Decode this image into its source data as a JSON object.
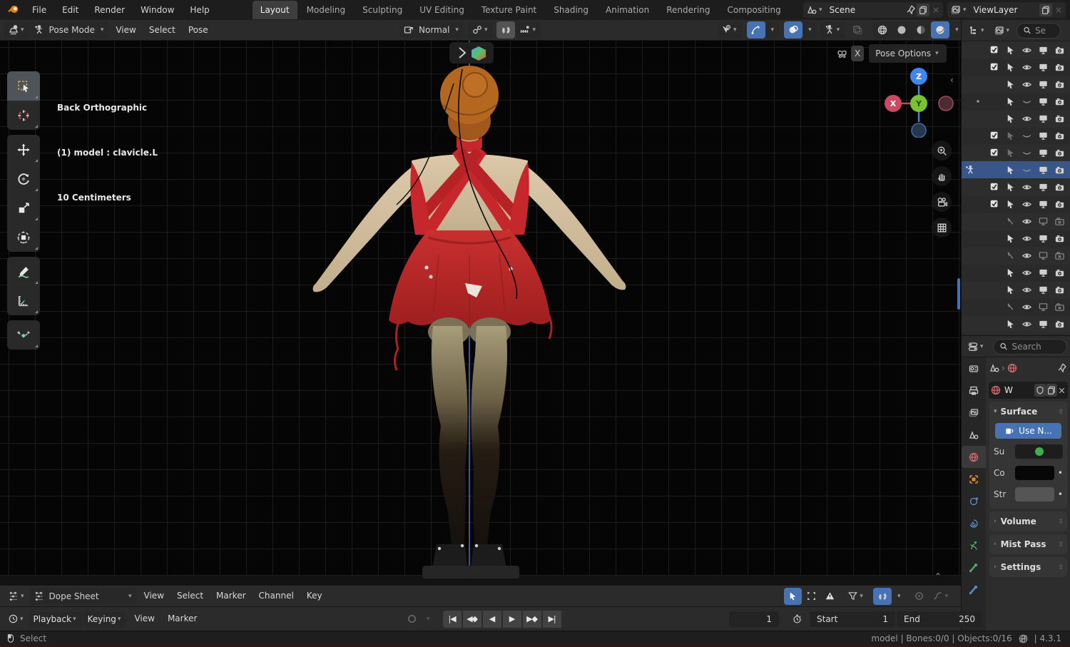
{
  "colors": {
    "accent": "#4772b3",
    "selection_row": "#38568a",
    "world_icon": "#d46a6a",
    "object_icon": "#e0862d",
    "data_icon": "#4fb06a",
    "physics_icon": "#5f8fd2",
    "dress_red": "#c5272c",
    "hair_orange": "#b4671f"
  },
  "topbar": {
    "menus": [
      "File",
      "Edit",
      "Render",
      "Window",
      "Help"
    ],
    "workspaces": [
      {
        "label": "Layout",
        "active": true
      },
      {
        "label": "Modeling"
      },
      {
        "label": "Sculpting"
      },
      {
        "label": "UV Editing"
      },
      {
        "label": "Texture Paint"
      },
      {
        "label": "Shading"
      },
      {
        "label": "Animation"
      },
      {
        "label": "Rendering"
      },
      {
        "label": "Compositing"
      }
    ],
    "scene_label": "Scene",
    "view_layer_label": "ViewLayer"
  },
  "viewport_header": {
    "mode": "Pose Mode",
    "menus": [
      "View",
      "Select",
      "Pose"
    ],
    "orientation": "Normal",
    "pose_options_label": "Pose Options",
    "close_label": "X"
  },
  "left_toolbar": [
    {
      "name": "box-select-tool",
      "active": true
    },
    {
      "name": "cursor-tool"
    },
    {
      "name": "move-tool"
    },
    {
      "name": "rotate-tool"
    },
    {
      "name": "scale-tool"
    },
    {
      "name": "transform-tool"
    },
    {
      "name": "annotate-tool"
    },
    {
      "name": "measure-tool"
    },
    {
      "name": "pose-breakdowner-tool"
    }
  ],
  "viewport": {
    "view_info": [
      "Back Orthographic",
      "(1) model : clavicle.L",
      "10 Centimeters"
    ],
    "gizmo": {
      "x": "X",
      "y": "Y",
      "z": "Z"
    }
  },
  "outliner": {
    "search_placeholder": "Se",
    "rows": [
      {
        "checkbox": true,
        "arrow": "solid",
        "eye": "open",
        "monitor": "solid",
        "camera": "solid"
      },
      {
        "checkbox": true,
        "arrow": "solid",
        "eye": "open",
        "monitor": "solid",
        "camera": "solid"
      },
      {
        "checkbox": false,
        "arrow": "solid",
        "eye": "open",
        "monitor": "solid",
        "camera": "solid"
      },
      {
        "checkbox": false,
        "dot": true,
        "arrow": "solid",
        "eye": "closed",
        "monitor": "solid",
        "camera": "solid"
      },
      {
        "checkbox": false,
        "arrow": "solid",
        "eye": "open",
        "monitor": "solid",
        "camera": "solid"
      },
      {
        "checkbox": true,
        "arrow": "faded",
        "eye": "closed",
        "monitor": "solid",
        "camera": "solid"
      },
      {
        "checkbox": true,
        "arrow": "faded",
        "eye": "closed",
        "monitor": "solid",
        "camera": "solid"
      },
      {
        "checkbox": false,
        "pose_icon": true,
        "selected": true,
        "arrow": "solid",
        "eye": "closed",
        "monitor": "solid",
        "camera": "solid"
      },
      {
        "checkbox": true,
        "arrow": "solid",
        "eye": "open",
        "monitor": "solid",
        "camera": "solid"
      },
      {
        "checkbox": true,
        "arrow": "solid",
        "eye": "open",
        "monitor": "solid",
        "camera": "solid"
      },
      {
        "checkbox": false,
        "arrow": "outline",
        "eye": "open",
        "monitor": "outline",
        "camera": "x"
      },
      {
        "checkbox": false,
        "arrow": "solid",
        "eye": "open",
        "monitor": "solid",
        "camera": "solid"
      },
      {
        "checkbox": false,
        "arrow": "outline",
        "eye": "open",
        "monitor": "outline",
        "camera": "x"
      },
      {
        "checkbox": false,
        "arrow": "solid",
        "eye": "open",
        "monitor": "solid",
        "camera": "solid"
      },
      {
        "checkbox": false,
        "arrow": "solid",
        "eye": "open",
        "monitor": "solid",
        "camera": "solid"
      },
      {
        "checkbox": false,
        "arrow": "outline",
        "eye": "open",
        "monitor": "outline",
        "camera": "x"
      },
      {
        "checkbox": false,
        "arrow": "solid",
        "eye": "open",
        "monitor": "solid",
        "camera": "solid"
      }
    ]
  },
  "properties": {
    "search_placeholder": "Search",
    "tabs": [
      {
        "name": "render"
      },
      {
        "name": "output"
      },
      {
        "name": "view-layer"
      },
      {
        "name": "scene"
      },
      {
        "name": "world",
        "active": true
      },
      {
        "name": "object"
      },
      {
        "name": "physics"
      },
      {
        "name": "constraints"
      },
      {
        "name": "object-data"
      },
      {
        "name": "bone"
      },
      {
        "name": "bone-constraints"
      }
    ],
    "datablock_name": "W",
    "surface": {
      "title": "Surface",
      "use_nodes_label": "Use N...",
      "fields": [
        {
          "label": "Su",
          "type": "color-green"
        },
        {
          "label": "Co",
          "type": "color-black"
        },
        {
          "label": "Str",
          "type": "slider"
        }
      ]
    },
    "collapsed_panels": [
      "Volume",
      "Mist Pass",
      "Settings"
    ]
  },
  "dope_sheet": {
    "editor_label": "Dope Sheet",
    "menus": [
      "View",
      "Select",
      "Marker",
      "Channel",
      "Key"
    ]
  },
  "timeline": {
    "playback_label": "Playback",
    "keying_label": "Keying",
    "menus": [
      "View",
      "Marker"
    ],
    "current_frame": "1",
    "start_label": "Start",
    "start_value": "1",
    "end_label": "End",
    "end_value": "250"
  },
  "status_bar": {
    "left": "Select",
    "stats": "model | Bones:0/0 | Objects:0/16",
    "version": "4.3.1"
  }
}
